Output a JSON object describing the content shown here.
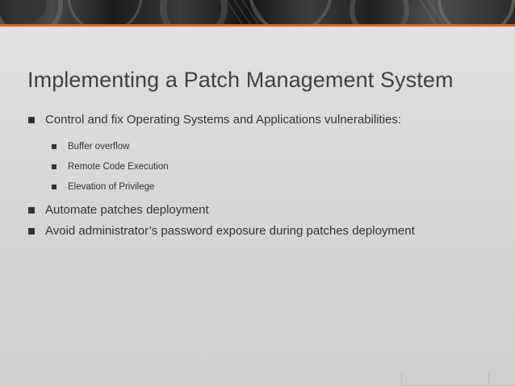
{
  "slide": {
    "title": "Implementing a Patch Management System",
    "bullets": [
      {
        "text": "Control and fix Operating Systems and Applications vulnerabilities:",
        "level": 1
      },
      {
        "text": "Buffer overflow",
        "level": 2
      },
      {
        "text": "Remote Code Execution",
        "level": 2
      },
      {
        "text": "Elevation of Privilege",
        "level": 2
      },
      {
        "text": "Automate patches deployment",
        "level": 1
      },
      {
        "text": "Avoid administrator’s password exposure during patches deployment",
        "level": 1
      }
    ]
  },
  "colors": {
    "accent_rule": "#d06a2c",
    "title_text": "#414141",
    "body_text": "#333333",
    "background": "#dadada"
  },
  "icons": {
    "bullet": "square-bullet-icon",
    "header_image": "gears-photo-icon"
  }
}
